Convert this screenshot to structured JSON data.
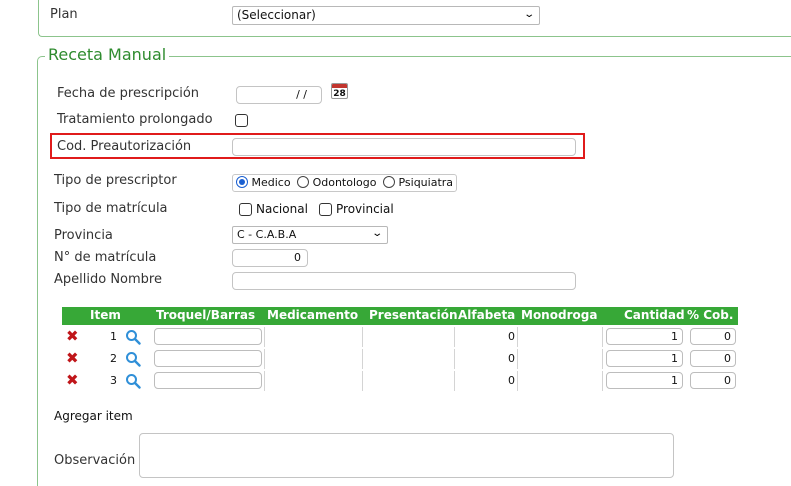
{
  "plan": {
    "label": "Plan",
    "value": "(Seleccionar)"
  },
  "section_title": "Receta Manual",
  "fecha": {
    "label": "Fecha de prescripción",
    "value": "/ /",
    "calendar_day": "28"
  },
  "tratamiento": {
    "label": "Tratamiento prolongado",
    "checked": false
  },
  "preautorizacion": {
    "label": "Cod. Preautorización",
    "value": ""
  },
  "tipo_prescriptor": {
    "label": "Tipo de prescriptor",
    "options": [
      "Medico",
      "Odontologo",
      "Psiquiatra"
    ],
    "selected": "Medico"
  },
  "tipo_matricula": {
    "label": "Tipo de matrícula",
    "options": [
      "Nacional",
      "Provincial"
    ]
  },
  "provincia": {
    "label": "Provincia",
    "value": "C - C.A.B.A"
  },
  "nro_matricula": {
    "label": "N° de matrícula",
    "value": "0"
  },
  "apellido": {
    "label": "Apellido Nombre",
    "value": ""
  },
  "table": {
    "headers": [
      "Item",
      "Troquel/Barras",
      "Medicamento",
      "Presentación",
      "Alfabeta",
      "Monodroga",
      "Cantidad",
      "% Cob."
    ],
    "rows": [
      {
        "item": "1",
        "alfabeta": "0",
        "cantidad": "1",
        "cob": "0"
      },
      {
        "item": "2",
        "alfabeta": "0",
        "cantidad": "1",
        "cob": "0"
      },
      {
        "item": "3",
        "alfabeta": "0",
        "cantidad": "1",
        "cob": "0"
      }
    ]
  },
  "agregar_item": "Agregar item",
  "observacion": {
    "label": "Observación",
    "value": ""
  },
  "colors": {
    "accent_green": "#37a837",
    "legend_green": "#2e8b2e",
    "highlight_red": "#e01b1b",
    "delete_red": "#c0161a"
  }
}
